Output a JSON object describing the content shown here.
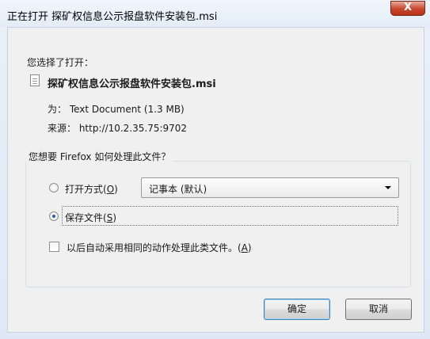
{
  "window": {
    "title": "正在打开 探矿权信息公示报盘软件安装包.msi",
    "close_glyph": "X"
  },
  "dialog": {
    "chosen_label": "您选择了打开：",
    "filename": "探矿权信息公示报盘软件安装包.msi",
    "type_line": "为： Text Document (1.3 MB)",
    "source_line": "来源： http://10.2.35.75:9702",
    "question": "您想要 Firefox 如何处理此文件？",
    "open_with": {
      "label": "打开方式(",
      "accel": "O",
      "suffix": ")",
      "selected": false
    },
    "app_select": {
      "value": "记事本 (默认)"
    },
    "save_file": {
      "label": "保存文件(",
      "accel": "S",
      "suffix": ")",
      "selected": true
    },
    "auto_checkbox": {
      "label": "以后自动采用相同的动作处理此类文件。(",
      "accel": "A",
      "suffix": ")",
      "checked": false
    }
  },
  "buttons": {
    "ok": "确定",
    "cancel": "取消"
  }
}
